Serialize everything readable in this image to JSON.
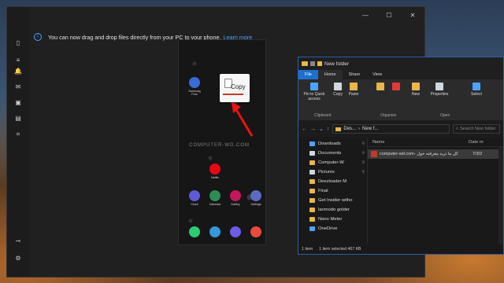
{
  "banner": {
    "message": "You can now drag and drop files directly from your PC to your phone.",
    "link": "Learn more"
  },
  "phone": {
    "apps": [
      {
        "label": "Samsung Free",
        "color": "#3a6ad8"
      },
      {
        "label": "Netflix",
        "color": "#e50914"
      },
      {
        "label": "Clock",
        "color": "#5b5bd6"
      },
      {
        "label": "Calendar",
        "color": "#2e8b57"
      },
      {
        "label": "Gallery",
        "color": "#c2185b"
      },
      {
        "label": "Settings",
        "color": "#5c6bc0"
      }
    ],
    "dock": [
      {
        "label": "Phone",
        "color": "#2ecc71"
      },
      {
        "label": "Messages",
        "color": "#3498db"
      },
      {
        "label": "Internet",
        "color": "#6c5ce7"
      },
      {
        "label": "Camera",
        "color": "#e74c3c"
      }
    ],
    "copy_label": "Copy",
    "watermark": "COMPUTER-WD.COM"
  },
  "explorer": {
    "title": "New folder",
    "tabs": [
      "File",
      "Home",
      "Share",
      "View"
    ],
    "ribbon": {
      "pin": "Pin to Quick access",
      "copy": "Copy",
      "paste": "Paste",
      "new": "New",
      "properties": "Properties",
      "select": "Select",
      "groups": [
        "Clipboard",
        "Organize",
        "Open"
      ]
    },
    "path": [
      "Des...",
      "New f..."
    ],
    "search_placeholder": "Search New folder",
    "nav_items": [
      {
        "label": "Downloads",
        "pinned": true,
        "color": "#4aa3ff"
      },
      {
        "label": "Documents",
        "pinned": true,
        "color": "#cfd8dc"
      },
      {
        "label": "Computer-W",
        "pinned": true,
        "color": "#e8b64a"
      },
      {
        "label": "Pictures",
        "pinned": true,
        "color": "#cfd8dc"
      },
      {
        "label": "Deezloader M",
        "pinned": false,
        "color": "#e8b64a"
      },
      {
        "label": "Final",
        "pinned": false,
        "color": "#e8b64a"
      },
      {
        "label": "Get Insider witho",
        "pinned": false,
        "color": "#e8b64a"
      },
      {
        "label": "lanmodo golder",
        "pinned": false,
        "color": "#e8b64a"
      },
      {
        "label": "Nano Meter",
        "pinned": false,
        "color": "#e8b64a"
      },
      {
        "label": "OneDrive",
        "pinned": false,
        "color": "#4aa3ff"
      }
    ],
    "columns": [
      "Name",
      "Date m"
    ],
    "file": {
      "name": "computer-wd.com- کل ما تريد معرفته حول",
      "date": "7/3/2"
    },
    "status": {
      "count": "1 item",
      "selected": "1 item selected  467 KB"
    }
  }
}
